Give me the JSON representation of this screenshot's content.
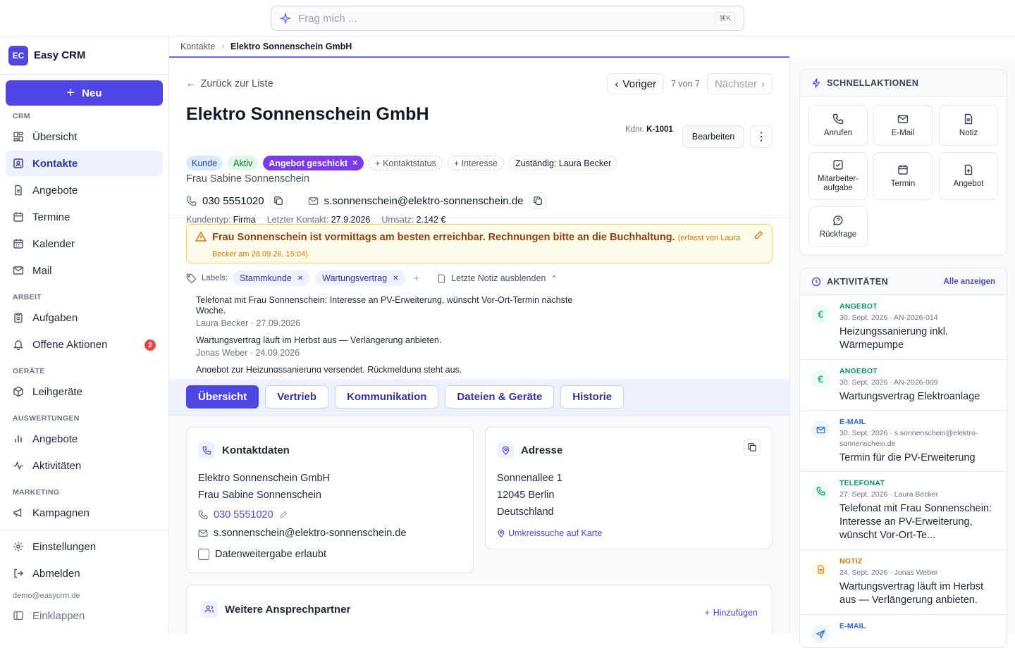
{
  "search": {
    "placeholder": "Frag mich ...",
    "shortcut": "⌘K"
  },
  "brand": {
    "logo": "EC",
    "name": "Easy CRM"
  },
  "sidebar": {
    "new_label": "Neu",
    "sections": {
      "crm": "CRM",
      "arbeit": "ARBEIT",
      "geraete": "GERÄTE",
      "auswertungen": "AUSWERTUNGEN",
      "marketing": "MARKETING"
    },
    "items": {
      "uebersicht": "Übersicht",
      "kontakte": "Kontakte",
      "angebote": "Angebote",
      "termine": "Termine",
      "kalender": "Kalender",
      "mail": "Mail",
      "aufgaben": "Aufgaben",
      "offene": "Offene Aktionen",
      "offene_count": "2",
      "leihgeraete": "Leihgeräte",
      "ausw_angebote": "Angebote",
      "aktivitaeten": "Aktivitäten",
      "kampagnen": "Kampagnen",
      "einstellungen": "Einstellungen",
      "abmelden": "Abmelden",
      "einklappen": "Einklappen"
    },
    "user_email": "demo@easycrm.de"
  },
  "breadcrumb": {
    "parent": "Kontakte",
    "current": "Elektro Sonnenschein GmbH"
  },
  "header": {
    "back": "Zurück zur Liste",
    "prev": "Voriger",
    "counter": "7 von 7",
    "next": "Nächster",
    "title": "Elektro Sonnenschein GmbH",
    "kdnr_label": "Kdnr.",
    "kdnr": "K-1001",
    "edit": "Bearbeiten",
    "tags": {
      "kunde": "Kunde",
      "aktiv": "Aktiv",
      "angebot": "Angebot geschickt",
      "kontaktstatus": "+ Kontaktstatus",
      "interesse": "+ Interesse",
      "zustaendig": "Zuständig: Laura Becker"
    },
    "person": "Frau Sabine Sonnenschein",
    "phone": "030 5551020",
    "email": "s.sonnenschein@elektro-sonnenschein.de",
    "meta": {
      "kundentyp_label": "Kundentyp:",
      "kundentyp": "Firma",
      "letzter_label": "Letzter Kontakt:",
      "letzter": "27.9.2026",
      "umsatz_label": "Umsatz:",
      "umsatz": "2.142 €"
    }
  },
  "pinned_note": {
    "text": "Frau Sonnenschein ist vormittags am besten erreichbar. Rechnungen bitte an die Buchhaltung.",
    "meta_a": "(erfasst von Laura",
    "meta_b": "Becker am 28.09.26, 15:04)"
  },
  "labels": {
    "title": "Labels:",
    "items": [
      "Stammkunde",
      "Wartungsvertrag"
    ],
    "toggle": "Letzte Notiz ausblenden"
  },
  "notes": [
    {
      "text": "Telefonat mit Frau Sonnenschein: Interesse an PV-Erweiterung, wünscht Vor-Ort-Termin nächste Woche.",
      "by": "Laura Becker · 27.09.2026"
    },
    {
      "text": "Wartungsvertrag läuft im Herbst aus — Verlängerung anbieten.",
      "by": "Jonas Weber · 24.09.2026"
    },
    {
      "text": "Angebot zur Heizungssanierung versendet. Rückmeldung steht aus.",
      "by": ""
    }
  ],
  "tabs": [
    "Übersicht",
    "Vertrieb",
    "Kommunikation",
    "Dateien & Geräte",
    "Historie"
  ],
  "kontaktdaten": {
    "title": "Kontaktdaten",
    "company": "Elektro Sonnenschein GmbH",
    "person": "Frau Sabine Sonnenschein",
    "phone": "030 5551020",
    "email": "s.sonnenschein@elektro-sonnenschein.de",
    "consent": "Datenweitergabe erlaubt"
  },
  "adresse": {
    "title": "Adresse",
    "street": "Sonnenallee 1",
    "city": "12045 Berlin",
    "country": "Deutschland",
    "map_link": "Umkreissuche auf Karte"
  },
  "ansprechpartner": {
    "title": "Weitere Ansprechpartner",
    "add": "Hinzufügen"
  },
  "quick": {
    "title": "SCHNELLAKTIONEN",
    "anrufen": "Anrufen",
    "email": "E-Mail",
    "notiz": "Notiz",
    "aufgabe_a": "Mitarbeiter-",
    "aufgabe_b": "aufgabe",
    "termin": "Termin",
    "angebot": "Angebot",
    "rueckfrage": "Rückfrage"
  },
  "activities": {
    "title": "AKTIVITÄTEN",
    "all": "Alle anzeigen",
    "items": [
      {
        "type": "ANGEBOT",
        "date": "30. Sept. 2026 · AN-2026-014",
        "title": "Heizungssanierung inkl. Wärmepumpe"
      },
      {
        "type": "ANGEBOT",
        "date": "30. Sept. 2026 · AN-2026-009",
        "title": "Wartungsvertrag Elektroanlage"
      },
      {
        "type": "E-MAIL",
        "date": "30. Sept. 2026 · s.sonnenschein@elektro-sonnenschein.de",
        "title": "Termin für die PV-Erweiterung"
      },
      {
        "type": "TELEFONAT",
        "date": "27. Sept. 2026 · Laura Becker",
        "title": "Telefonat mit Frau Sonnenschein: Interesse an PV-Erweiterung, wünscht Vor-Ort-Te..."
      },
      {
        "type": "NOTIZ",
        "date": "24. Sept. 2026 · Jonas Weber",
        "title": "Wartungsvertrag läuft im Herbst aus — Verlängerung anbieten."
      },
      {
        "type": "E-MAIL",
        "date": "",
        "title": ""
      }
    ]
  },
  "colors": {
    "accent": "#4f46e5",
    "angebot": "#059669",
    "email": "#2563eb",
    "telefonat": "#059669",
    "notiz": "#d97706"
  }
}
